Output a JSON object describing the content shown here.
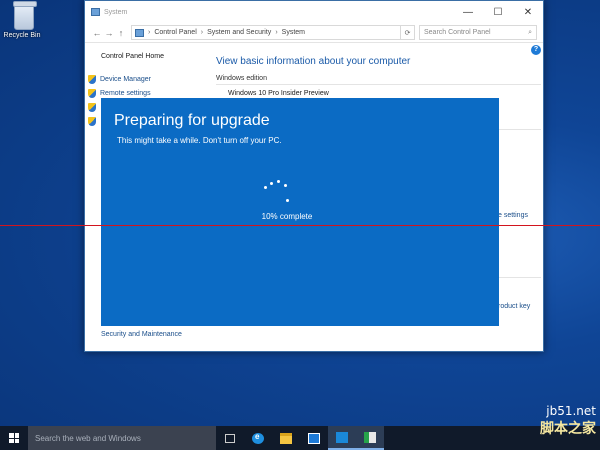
{
  "desktop": {
    "recycle_bin_label": "Recycle Bin"
  },
  "window": {
    "title": "System",
    "minimize": "—",
    "maximize": "☐",
    "close": "✕",
    "address": {
      "back": "←",
      "forward": "→",
      "up": "↑",
      "crumbs": [
        "Control Panel",
        "System and Security",
        "System"
      ],
      "search_placeholder": "Search Control Panel"
    },
    "help": "?",
    "sidebar": {
      "home": "Control Panel Home",
      "items": [
        "Device Manager",
        "Remote settings"
      ],
      "see_also": "Security and Maintenance"
    },
    "main": {
      "heading": "View basic information about your computer",
      "section": "Windows edition",
      "edition": "Windows 10 Pro Insider Preview",
      "link_settings": "e settings",
      "link_product_key": "roduct key"
    }
  },
  "upgrade": {
    "title": "Preparing for upgrade",
    "subtitle": "This might take a while. Don't turn off your PC.",
    "progress_value": 10,
    "progress_text": "10% complete"
  },
  "taskbar": {
    "search_placeholder": "Search the web and Windows",
    "icons": [
      "task-view-icon",
      "edge-icon",
      "file-explorer-icon",
      "store-icon",
      "settings-icon",
      "console-icon"
    ]
  },
  "watermark": {
    "site": "jb51.net",
    "brand": "脚本之家"
  },
  "colors": {
    "overlay": "#0b6bc4",
    "desktop": "#0f4596",
    "taskbar": "#101a2a",
    "red_line": "#d4141c"
  }
}
